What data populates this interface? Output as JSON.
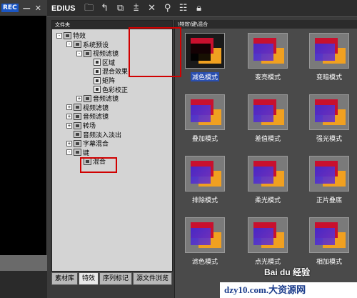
{
  "left_panel": {
    "rec_badge": "REC",
    "minimize": "—",
    "close": "✕"
  },
  "toolbar": {
    "app_title": "EDIUS",
    "icons": [
      "folder-icon",
      "up-icon",
      "copy-icon",
      "arrange-icon",
      "delete-icon",
      "search-icon",
      "view-icon",
      "lock-icon"
    ]
  },
  "folder_panel": {
    "header": "文件夹",
    "tree": [
      {
        "label": "特效",
        "level": 0,
        "expander": "-"
      },
      {
        "label": "系统预设",
        "level": 1,
        "expander": "-"
      },
      {
        "label": "视频滤镜",
        "level": 2,
        "expander": "-"
      },
      {
        "label": "区域",
        "level": 3,
        "expander": ""
      },
      {
        "label": "混合效果",
        "level": 3,
        "expander": ""
      },
      {
        "label": "矩阵",
        "level": 3,
        "expander": ""
      },
      {
        "label": "色彩校正",
        "level": 3,
        "expander": ""
      },
      {
        "label": "音频滤镜",
        "level": 2,
        "expander": "+"
      },
      {
        "label": "视频滤镜",
        "level": 1,
        "expander": "+"
      },
      {
        "label": "音频滤镜",
        "level": 1,
        "expander": "+"
      },
      {
        "label": "转场",
        "level": 1,
        "expander": "+"
      },
      {
        "label": "音频淡入淡出",
        "level": 1,
        "expander": ""
      },
      {
        "label": "字幕混合",
        "level": 1,
        "expander": "+"
      },
      {
        "label": "键",
        "level": 1,
        "expander": "-"
      },
      {
        "label": "混合",
        "level": 2,
        "expander": ""
      }
    ]
  },
  "tabs": [
    "素材库",
    "特效",
    "序列标记",
    "源文件浏览"
  ],
  "grid_panel": {
    "path": "\\特效\\键\\混合",
    "effects": [
      "减色模式",
      "变亮模式",
      "变暗模式",
      "叠加模式",
      "差值模式",
      "强光模式",
      "排除模式",
      "柔光模式",
      "正片叠底",
      "滤色模式",
      "点光模式",
      "相加模式"
    ]
  },
  "watermark": {
    "logo": "Bai du 经验",
    "site": "dzy10.com.大资源网"
  },
  "colors": {
    "highlight_red": "#d00000",
    "selection_blue": "#2a4fb0"
  }
}
